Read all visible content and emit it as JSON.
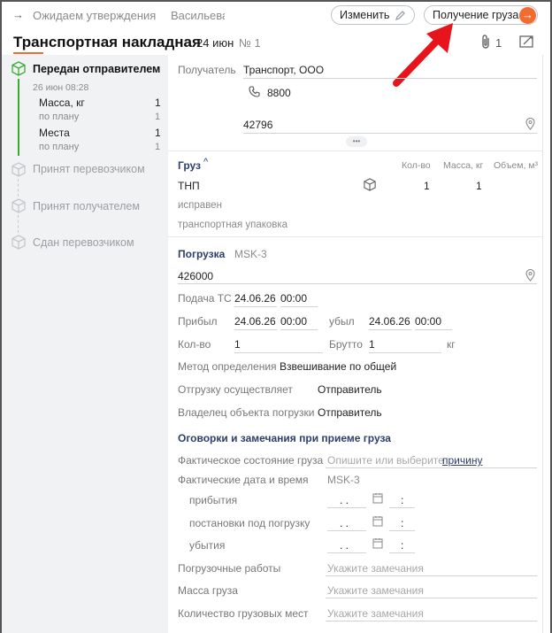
{
  "header": {
    "status_label": "Ожидаем утверждения",
    "user_name": "Васильева",
    "edit_button": "Изменить",
    "receive_button": "Получение груза",
    "doc_title": "Транспортная накладная",
    "doc_date": "24 июн",
    "doc_number": "№ 1",
    "attachments_count": "1"
  },
  "sidebar": {
    "stage1": {
      "title": "Передан отправителем",
      "date": "26 июн 08:28",
      "rows": [
        {
          "label": "Масса, кг",
          "value": "1"
        },
        {
          "label": "по плану",
          "value": "1"
        },
        {
          "label": "Места",
          "value": "1"
        },
        {
          "label": "по плану",
          "value": "1"
        }
      ]
    },
    "stage2": "Принят перевозчиком",
    "stage3": "Принят получателем",
    "stage4": "Сдан перевозчиком"
  },
  "recipient": {
    "label": "Получатель",
    "name": "Транспорт, ООО",
    "phone": "8800",
    "address": "42796",
    "more": "•••"
  },
  "cargo": {
    "title": "Груз",
    "col_qty": "Кол-во",
    "col_mass": "Масса, кг",
    "col_volume": "Объем, м³",
    "row_name": "ТНП",
    "row_qty": "1",
    "row_mass": "1",
    "condition": "исправен",
    "packaging": "транспортная упаковка"
  },
  "loading": {
    "title": "Погрузка",
    "timezone": "MSK-3",
    "address": "426000",
    "supply_label": "Подача ТС",
    "supply_date": "24.06.26",
    "supply_time": "00:00",
    "arrived_label": "Прибыл",
    "arrived_date": "24.06.26",
    "arrived_time": "00:00",
    "left_label": "убыл",
    "left_date": "24.06.26",
    "left_time": "00:00",
    "qty_label": "Кол-во",
    "qty_value": "1",
    "gross_label": "Брутто",
    "gross_value": "1",
    "gross_unit": "кг",
    "method_label": "Метод определения",
    "method_value": "Взвешивание по общей",
    "shipper_label": "Отгрузку осуществляет",
    "shipper_value": "Отправитель",
    "owner_label": "Владелец объекта погрузки",
    "owner_value": "Отправитель"
  },
  "remarks": {
    "title": "Оговорки и замечания при приеме груза",
    "actual_state_label": "Фактическое состояние груза",
    "actual_state_placeholder": "Опишите или выберите",
    "actual_state_link": "причину",
    "actual_dt_label": "Фактические дата и время",
    "actual_dt_tz": "MSK-3",
    "arrival_label": "прибытия",
    "placement_label": "постановки под погрузку",
    "departure_label": "убытия",
    "date_mask": ".  .",
    "time_mask": ":",
    "loading_works_label": "Погрузочные работы",
    "cargo_mass_label": "Масса груза",
    "cargo_places_label": "Количество грузовых мест",
    "remarks_placeholder": "Укажите замечания"
  },
  "colors": {
    "accent_orange": "#f26b2f",
    "green": "#3aaa35",
    "arrow_red": "#e8141b"
  }
}
